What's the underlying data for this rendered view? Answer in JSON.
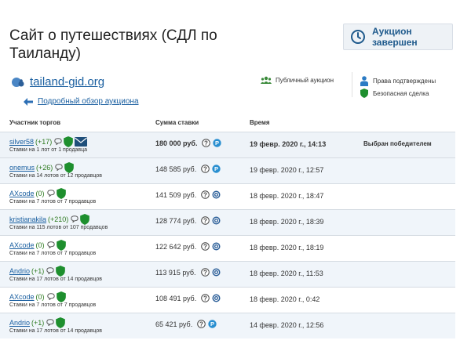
{
  "header": {
    "title": "Сайт о путешествиях (СДЛ по Таиланду)",
    "status": "Аукцион завершен"
  },
  "site": {
    "domain": "tailand-gid.org",
    "review_link": "Подробный обзор аукциона"
  },
  "info": {
    "public_auction": "Публичный аукцион",
    "rights_confirmed": "Права подтверждены",
    "safe_deal": "Безопасная сделка"
  },
  "table": {
    "columns": [
      "Участник торгов",
      "Сумма ставки",
      "Время"
    ],
    "rows": [
      {
        "name": "silver58",
        "rating": "(+17)",
        "sub": "Ставки на 1 лот от 1 продавца",
        "amount": "180 000 руб.",
        "time": "19 февр. 2020 г., 14:13",
        "note": "Выбран победителем"
      },
      {
        "name": "onemus",
        "rating": "(+26)",
        "sub": "Ставки на 14 лотов от 12 продавцов",
        "amount": "148 585 руб.",
        "time": "19 февр. 2020 г., 12:57",
        "note": ""
      },
      {
        "name": "AXcode",
        "rating": "(0)",
        "sub": "Ставки на 7 лотов от 7 продавцов",
        "amount": "141 509 руб.",
        "time": "18 февр. 2020 г., 18:47",
        "note": ""
      },
      {
        "name": "kristianakila",
        "rating": "(+210)",
        "sub": "Ставки на 115 лотов от 107 продавцов",
        "amount": "128 774 руб.",
        "time": "18 февр. 2020 г., 18:39",
        "note": ""
      },
      {
        "name": "AXcode",
        "rating": "(0)",
        "sub": "Ставки на 7 лотов от 7 продавцов",
        "amount": "122 642 руб.",
        "time": "18 февр. 2020 г., 18:19",
        "note": ""
      },
      {
        "name": "Andrio",
        "rating": "(+1)",
        "sub": "Ставки на 17 лотов от 14 продавцов",
        "amount": "113 915 руб.",
        "time": "18 февр. 2020 г., 11:53",
        "note": ""
      },
      {
        "name": "AXcode",
        "rating": "(0)",
        "sub": "Ставки на 7 лотов от 7 продавцов",
        "amount": "108 491 руб.",
        "time": "18 февр. 2020 г., 0:42",
        "note": ""
      },
      {
        "name": "Andrio",
        "rating": "(+1)",
        "sub": "Ставки на 17 лотов от 14 продавцов",
        "amount": "65 421 руб.",
        "time": "14 февр. 2020 г., 12:56",
        "note": ""
      }
    ]
  },
  "colors": {
    "link": "#1a5fa0",
    "rating": "#2d7a1f",
    "shield": "#1e8f2e",
    "status_text": "#1f5a8c"
  },
  "icons": {
    "status": "clock-icon",
    "site": "globe-people-icon",
    "back": "arrow-left-icon",
    "public": "group-icon",
    "rights": "person-icon",
    "safe": "shield-icon",
    "chat": "chat-bubble-icon",
    "verified": "shield-icon",
    "mail": "envelope-icon",
    "help": "question-icon",
    "payment": "payment-system-icon"
  }
}
